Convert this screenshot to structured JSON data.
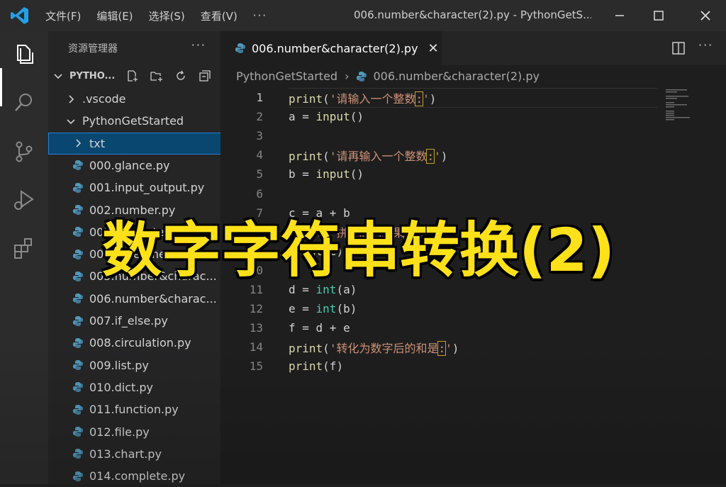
{
  "titlebar": {
    "menu": [
      "文件(F)",
      "编辑(E)",
      "选择(S)",
      "查看(V)"
    ],
    "more": "···",
    "window_title": "006.number&character(2).py - PythonGetS..."
  },
  "sidebar": {
    "header": "资源管理器",
    "more": "···",
    "project": "PYTHO...",
    "items": [
      {
        "label": ".vscode",
        "type": "folder",
        "indent": 1
      },
      {
        "label": "PythonGetStarted",
        "type": "folder-open",
        "indent": 1
      },
      {
        "label": "txt",
        "type": "folder",
        "indent": 2,
        "selected": true
      },
      {
        "label": "000.glance.py",
        "type": "py",
        "indent": 2
      },
      {
        "label": "001.input_output.py",
        "type": "py",
        "indent": 2
      },
      {
        "label": "002.number.py",
        "type": "py",
        "indent": 2
      },
      {
        "label": "003.character.py",
        "type": "py",
        "indent": 2
      },
      {
        "label": "004.datetime.py",
        "type": "py",
        "indent": 2
      },
      {
        "label": "005.number&charac...",
        "type": "py",
        "indent": 2
      },
      {
        "label": "006.number&charac...",
        "type": "py",
        "indent": 2
      },
      {
        "label": "007.if_else.py",
        "type": "py",
        "indent": 2
      },
      {
        "label": "008.circulation.py",
        "type": "py",
        "indent": 2
      },
      {
        "label": "009.list.py",
        "type": "py",
        "indent": 2
      },
      {
        "label": "010.dict.py",
        "type": "py",
        "indent": 2
      },
      {
        "label": "011.function.py",
        "type": "py",
        "indent": 2
      },
      {
        "label": "012.file.py",
        "type": "py",
        "indent": 2
      },
      {
        "label": "013.chart.py",
        "type": "py",
        "indent": 2
      },
      {
        "label": "014.complete.py",
        "type": "py",
        "indent": 2
      }
    ]
  },
  "editor": {
    "tab_label": "006.number&character(2).py",
    "breadcrumb": [
      "PythonGetStarted",
      "006.number&character(2).py"
    ],
    "lines": [
      {
        "n": "1",
        "tokens": [
          [
            "fn",
            "print"
          ],
          [
            "p",
            "("
          ],
          [
            "str",
            "'请输入一个整数"
          ],
          [
            "box",
            ":"
          ],
          [
            "str",
            "'"
          ],
          [
            "p",
            ")"
          ]
        ]
      },
      {
        "n": "2",
        "tokens": [
          [
            "p",
            "a = "
          ],
          [
            "fn",
            "input"
          ],
          [
            "p",
            "()"
          ]
        ]
      },
      {
        "n": "3",
        "tokens": []
      },
      {
        "n": "4",
        "tokens": [
          [
            "fn",
            "print"
          ],
          [
            "p",
            "("
          ],
          [
            "str",
            "'请再输入一个整数"
          ],
          [
            "box",
            ":"
          ],
          [
            "str",
            "'"
          ],
          [
            "p",
            ")"
          ]
        ]
      },
      {
        "n": "5",
        "tokens": [
          [
            "p",
            "b = "
          ],
          [
            "fn",
            "input"
          ],
          [
            "p",
            "()"
          ]
        ]
      },
      {
        "n": "6",
        "tokens": []
      },
      {
        "n": "7",
        "tokens": [
          [
            "p",
            "c = a + b"
          ]
        ]
      },
      {
        "n": "8",
        "tokens": [
          [
            "fn",
            "print"
          ],
          [
            "p",
            "("
          ],
          [
            "str",
            "'拼接后的结果"
          ],
          [
            "box",
            ":"
          ],
          [
            "str",
            "'"
          ],
          [
            "p",
            ")"
          ]
        ]
      },
      {
        "n": "9",
        "tokens": [
          [
            "fn",
            "print"
          ],
          [
            "p",
            "(c)"
          ]
        ]
      },
      {
        "n": "10",
        "tokens": []
      },
      {
        "n": "11",
        "tokens": [
          [
            "p",
            "d = "
          ],
          [
            "kw",
            "int"
          ],
          [
            "p",
            "(a)"
          ]
        ]
      },
      {
        "n": "12",
        "tokens": [
          [
            "p",
            "e = "
          ],
          [
            "kw",
            "int"
          ],
          [
            "p",
            "(b)"
          ]
        ]
      },
      {
        "n": "13",
        "tokens": [
          [
            "p",
            "f = d + e"
          ]
        ]
      },
      {
        "n": "14",
        "tokens": [
          [
            "fn",
            "print"
          ],
          [
            "p",
            "("
          ],
          [
            "str",
            "'转化为数字后的和是"
          ],
          [
            "box",
            ":"
          ],
          [
            "str",
            "'"
          ],
          [
            "p",
            ")"
          ]
        ]
      },
      {
        "n": "15",
        "tokens": [
          [
            "fn",
            "print"
          ],
          [
            "p",
            "(f)"
          ]
        ]
      }
    ]
  },
  "overlay": {
    "caption": "数字字符串转换(2)"
  },
  "colors": {
    "accent": "#0e639c",
    "caption": "#ffe11a",
    "python_icon": "#519aba"
  }
}
